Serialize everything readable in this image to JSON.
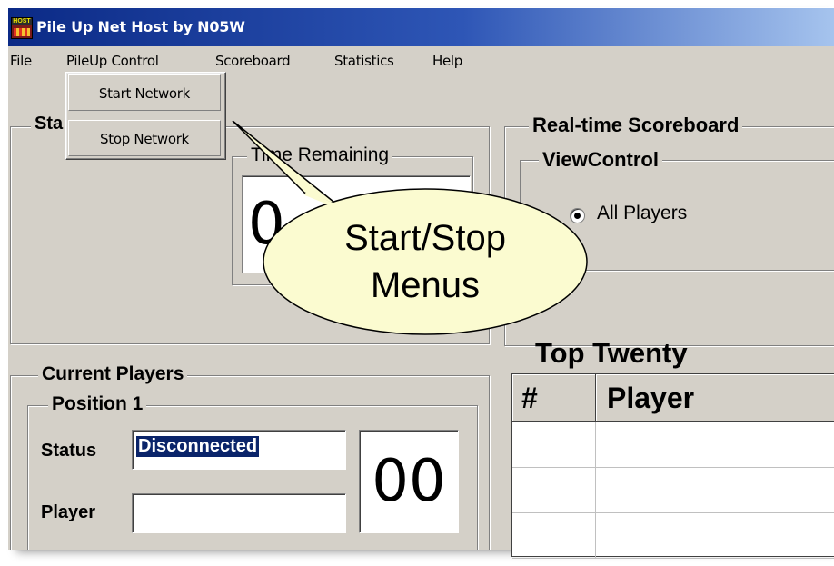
{
  "window": {
    "title": "Pile Up Net Host by N05W",
    "icon_text": "HOST"
  },
  "menubar": {
    "items": [
      "File",
      "PileUp Control",
      "Scoreboard",
      "Statistics",
      "Help"
    ]
  },
  "dropdown": {
    "items": [
      "Start Network",
      "Stop Network"
    ]
  },
  "status_group": {
    "label": "Sta"
  },
  "time_remaining": {
    "label": "Time Remaining",
    "digits": "0"
  },
  "scoreboard": {
    "title": "Real-time Scoreboard",
    "view_label": "ViewControl",
    "radio_label": "All Players"
  },
  "current_players": {
    "label": "Current Players",
    "position_label": "Position 1",
    "status_label": "Status",
    "status_value": "Disconnected",
    "player_label": "Player",
    "player_value": "",
    "count": "00"
  },
  "top_twenty": {
    "title": "Top Twenty",
    "columns": [
      "#",
      "Player"
    ]
  },
  "callout": {
    "line1": "Start/Stop",
    "line2": "Menus"
  },
  "colors": {
    "face": "#d4d0c8",
    "title_start": "#0b2a86",
    "title_end": "#a6c4ee",
    "selection": "#0a246a",
    "callout_fill": "#fbfbd0"
  }
}
